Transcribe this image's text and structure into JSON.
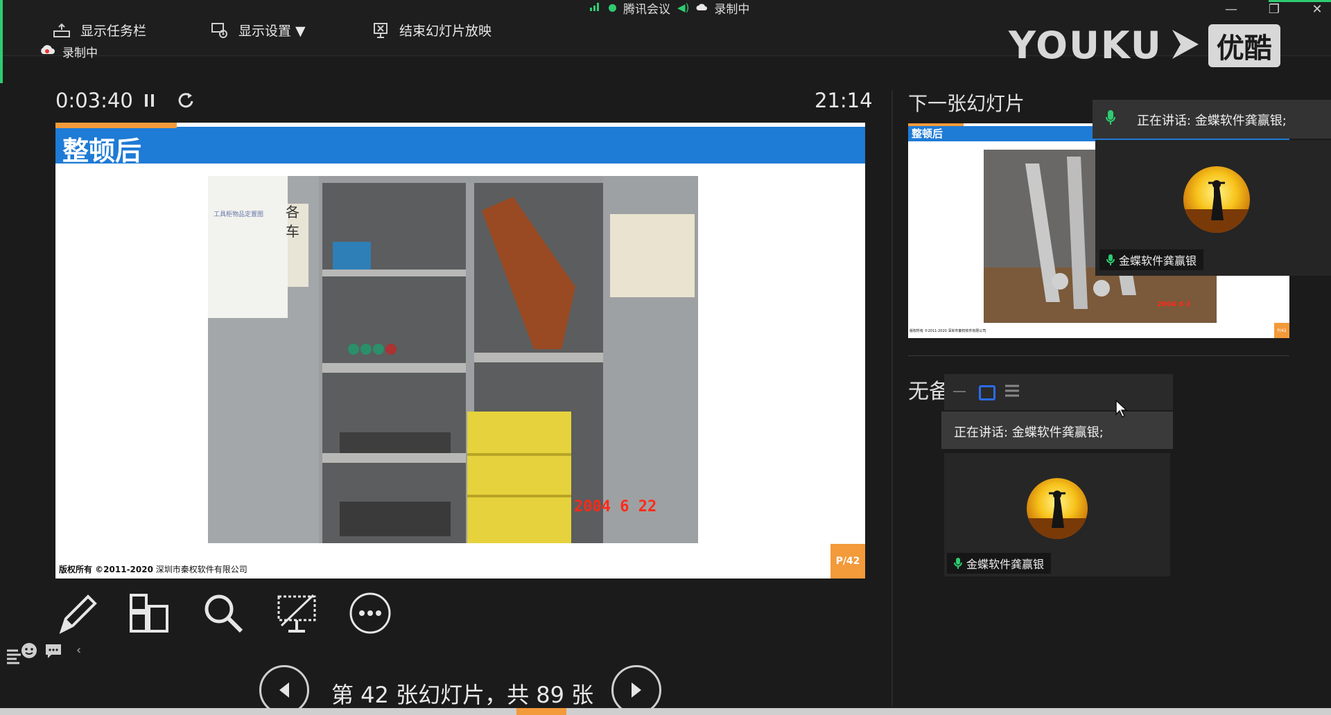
{
  "topbar": {
    "show_taskbar": "显示任务栏",
    "display_settings": "显示设置 ▼",
    "end_slideshow": "结束幻灯片放映",
    "recording": "录制中"
  },
  "status": {
    "app_name": "腾讯会议",
    "recording": "录制中"
  },
  "watermark": {
    "brand_en": "YOUKU",
    "brand_cn": "优酷"
  },
  "presenter": {
    "elapsed": "0:03:40",
    "clock": "21:14",
    "next_slide_label": "下一张幻灯片",
    "notes_label": "无备注"
  },
  "slide": {
    "title": "整顿后",
    "footer_bold": "版权所有 ©2011-2020",
    "footer_company": "深圳市秦权软件有限公司",
    "page": "P/42",
    "photo_date": "2004  6  22",
    "photo_sign_small": "工具柜物品定置图",
    "photo_sign_big": "各 车"
  },
  "next_slide": {
    "title": "整顿后",
    "page": "P/42",
    "footer": "版权所有 ©2011-2020 深圳市秦权软件有限公司",
    "photo_date": "2004 6 2"
  },
  "navigation": {
    "label": "第 42 张幻灯片，共 89 张"
  },
  "meeting_panel_top": {
    "speaking": "正在讲话: 金蝶软件龚赢银;",
    "participant": "金蝶软件龚赢银"
  },
  "meeting_panel_float": {
    "speaking": "正在讲话: 金蝶软件龚赢银;",
    "participant": "金蝶软件龚赢银"
  },
  "colors": {
    "slide_header": "#1e7bd6",
    "accent_orange": "#f39a3a",
    "green": "#2ecc71",
    "background": "#1b1b1b"
  }
}
